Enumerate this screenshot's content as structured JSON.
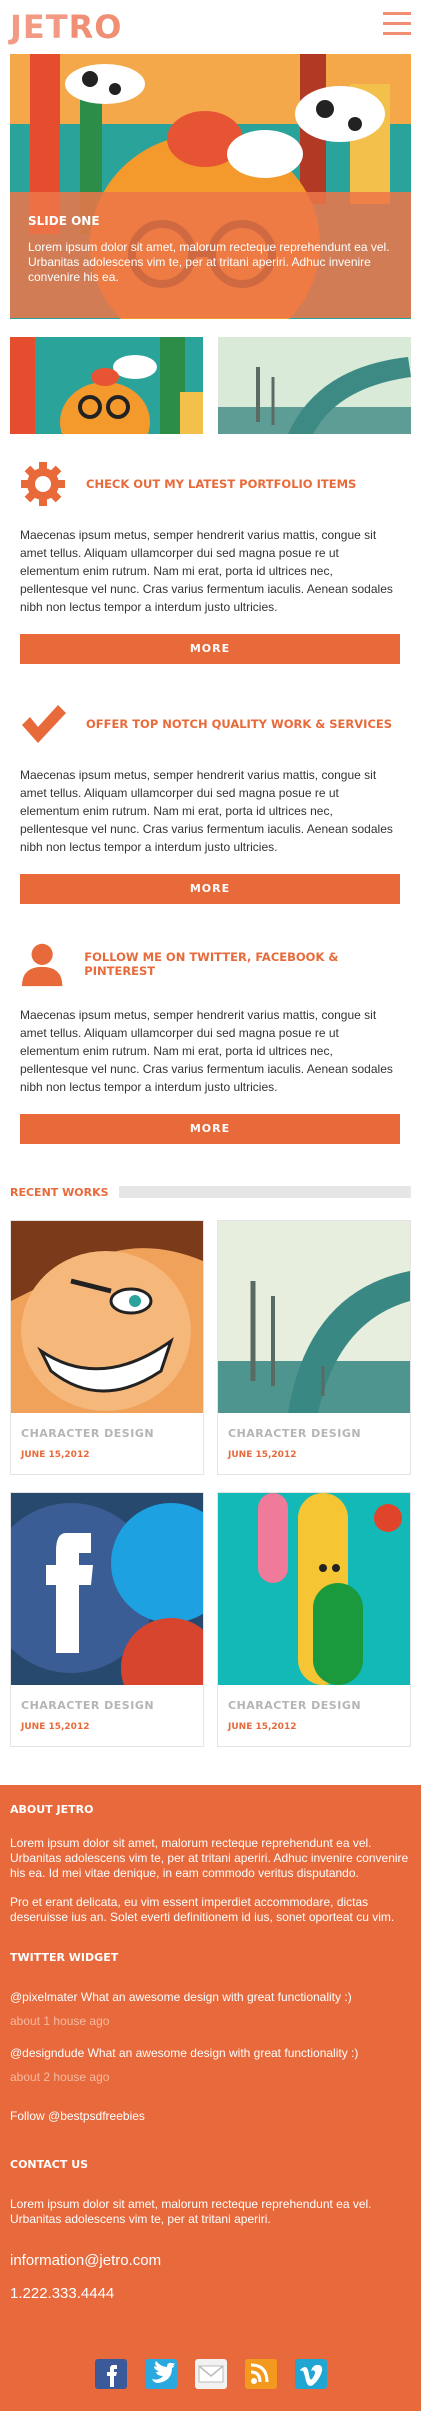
{
  "header": {
    "logo_part1": "JET",
    "logo_part2": "RO"
  },
  "slider": {
    "title": "SLIDE ONE",
    "description": "Lorem ipsum dolor sit amet, malorum recteque reprehendunt ea vel. Urbanitas adolescens vim te, per at tritani aperiri. Adhuc invenire convenire his ea."
  },
  "features": [
    {
      "icon": "gear-icon",
      "title": "CHECK OUT MY LATEST PORTFOLIO ITEMS",
      "text": "Maecenas ipsum metus, semper hendrerit varius mattis, congue sit amet tellus. Aliquam ullamcorper dui sed magna posue re ut elementum enim rutrum. Nam mi erat, porta id ultrices nec, pellentesque vel nunc. Cras varius fermentum iaculis. Aenean sodales nibh non lectus tempor a interdum justo ultricies.",
      "button": "MORE"
    },
    {
      "icon": "checkmark-icon",
      "title": "OFFER TOP NOTCH QUALITY WORK & SERVICES",
      "text": "Maecenas ipsum metus, semper hendrerit varius mattis, congue sit amet tellus. Aliquam ullamcorper dui sed magna posue re ut elementum enim rutrum. Nam mi erat, porta id ultrices nec, pellentesque vel nunc. Cras varius fermentum iaculis. Aenean sodales nibh non lectus tempor a interdum justo ultricies.",
      "button": "MORE"
    },
    {
      "icon": "user-icon",
      "title": "FOLLOW ME ON TWITTER, FACEBOOK & PINTEREST",
      "text": "Maecenas ipsum metus, semper hendrerit varius mattis, congue sit amet tellus. Aliquam ullamcorper dui sed magna posue re ut elementum enim rutrum. Nam mi erat, porta id ultrices nec, pellentesque vel nunc. Cras varius fermentum iaculis. Aenean sodales nibh non lectus tempor a interdum justo ultricies.",
      "button": "MORE"
    }
  ],
  "recent_works": {
    "title": "RECENT WORKS",
    "items": [
      {
        "title": "CHARACTER DESIGN",
        "date": "JUNE 15,2012"
      },
      {
        "title": "CHARACTER DESIGN",
        "date": "JUNE 15,2012"
      },
      {
        "title": "CHARACTER DESIGN",
        "date": "JUNE 15,2012"
      },
      {
        "title": "CHARACTER DESIGN",
        "date": "JUNE 15,2012"
      }
    ]
  },
  "footer": {
    "about_title": "ABOUT JETRO",
    "about_p1": "Lorem ipsum dolor sit amet, malorum recteque reprehendunt ea vel. Urbanitas adolescens vim te, per at tritani aperiri. Adhuc invenire convenire his ea. Id mei vitae denique, in eam commodo veritus disputando.",
    "about_p2": "Pro et erant delicata, eu vim essent imperdiet accommodare, dictas deseruisse ius an. Solet everti definitionem id ius, sonet oporteat cu vim.",
    "twitter_title": "TWITTER WIDGET",
    "tweets": [
      {
        "handle": "@pixelmater",
        "text": " What an awesome design with great functionality :)",
        "time": "about 1 house ago"
      },
      {
        "handle": "@designdude",
        "text": " What an awesome design with great functionality :)",
        "time": "about 2 house ago"
      }
    ],
    "follow": "Follow @bestpsdfreebies",
    "contact_title": "CONTACT US",
    "contact_text": "Lorem ipsum dolor sit amet, malorum recteque reprehendunt ea vel. Urbanitas adolescens vim te, per at tritani aperiri.",
    "email": "information@jetro.com",
    "phone": "1.222.333.4444",
    "social_icons": [
      "facebook-icon",
      "twitter-icon",
      "mail-icon",
      "rss-icon",
      "vimeo-icon"
    ]
  },
  "colors": {
    "accent": "#e86a3a",
    "logo": "#f08f74"
  }
}
